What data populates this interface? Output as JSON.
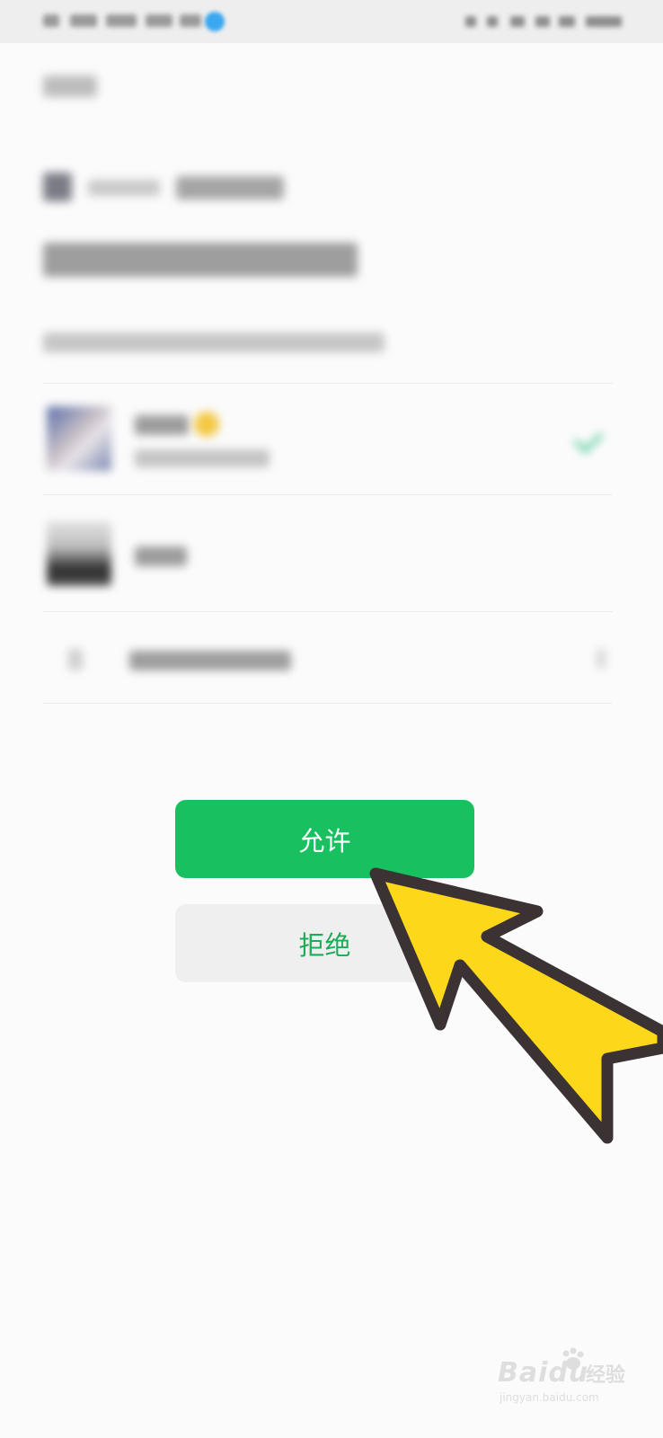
{
  "dialog": {
    "allow_label": "允许",
    "deny_label": "拒绝"
  },
  "watermark": {
    "logo_text": "Baidu",
    "suffix_text": "经验",
    "url": "jingyan.baidu.com"
  },
  "colors": {
    "allow_bg": "#18c05f",
    "deny_bg": "#efefef",
    "deny_text": "#1aad55",
    "arrow_fill": "#fdd71a",
    "arrow_stroke": "#3b3333"
  }
}
